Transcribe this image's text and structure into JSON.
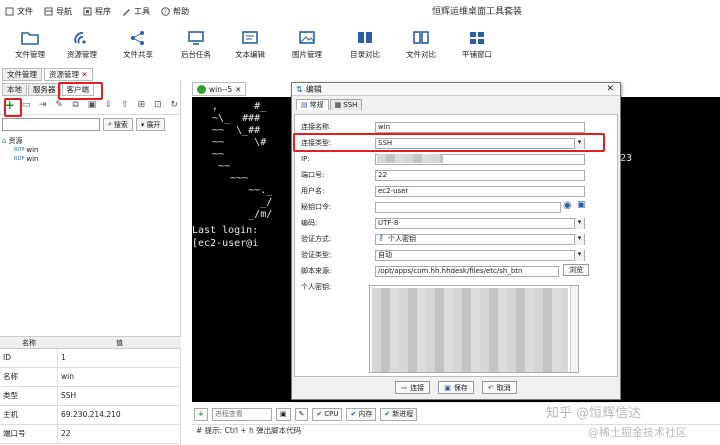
{
  "app": {
    "title": "恒辉运维桌面工具套装"
  },
  "menu": [
    {
      "label": "文件",
      "icon": "file-icon"
    },
    {
      "label": "导航",
      "icon": "navigation-icon"
    },
    {
      "label": "程序",
      "icon": "program-icon"
    },
    {
      "label": "工具",
      "icon": "tools-icon"
    },
    {
      "label": "帮助",
      "icon": "help-icon"
    }
  ],
  "toolbar": [
    {
      "label": "文件管理",
      "icon": "folder-icon"
    },
    {
      "label": "资源管理",
      "icon": "resource-icon"
    },
    {
      "label": "文件共享",
      "icon": "share-icon"
    },
    {
      "label": "后台任务",
      "icon": "monitor-icon"
    },
    {
      "label": "文本编辑",
      "icon": "text-edit-icon"
    },
    {
      "label": "图片管理",
      "icon": "image-icon"
    },
    {
      "label": "目录对比",
      "icon": "dir-compare-icon"
    },
    {
      "label": "文件对比",
      "icon": "file-compare-icon"
    },
    {
      "label": "平铺窗口",
      "icon": "tile-window-icon"
    }
  ],
  "top_tabs": [
    "文件管理",
    "资源管理"
  ],
  "sub_tabs": [
    "本地",
    "服务器",
    "客户端"
  ],
  "search": {
    "button": "搜索",
    "expand": "展开"
  },
  "tree": {
    "root": "资源",
    "children": [
      "win",
      "win"
    ]
  },
  "props": {
    "headers": [
      "名称",
      "值"
    ],
    "rows": [
      [
        "ID",
        "1"
      ],
      [
        "名称",
        "win"
      ],
      [
        "类型",
        "SSH"
      ],
      [
        "主机",
        "69.230.214.210"
      ],
      [
        "端口号",
        "22"
      ]
    ]
  },
  "terminal": {
    "tab_label": "win--5",
    "right_fragment": "23",
    "lines": [
      "  ,      #_",
      "  ~\\_  ###",
      "  ~~  \\_##",
      "  ~~     \\#",
      "  ~~",
      "   ~~",
      "     ~~~",
      "        ~~._",
      "          _/",
      "        _/m/",
      "Last login:",
      "[ec2-user@i"
    ]
  },
  "bottom": {
    "process_placeholder": "进程查看",
    "cpu": "CPU",
    "memory": "内存",
    "new_process": "新进程",
    "hint": "# 提示: Ctrl + h 弹出脚本代码"
  },
  "dialog": {
    "title": "编辑",
    "tabs": [
      "常规",
      "SSH"
    ],
    "fields": {
      "conn_name": {
        "label": "连接名称:",
        "value": "win"
      },
      "conn_type": {
        "label": "连接类型:",
        "value": "SSH"
      },
      "ip": {
        "label": "IP:",
        "value": ""
      },
      "port": {
        "label": "端口号:",
        "value": "22"
      },
      "username": {
        "label": "用户名:",
        "value": "ec2-user"
      },
      "password": {
        "label": "秘钥口令:",
        "value": ""
      },
      "encoding": {
        "label": "编码:",
        "value": "UTF-8"
      },
      "auth_method": {
        "label": "验证方式:",
        "value": "个人密钥"
      },
      "auth_type": {
        "label": "验证类型:",
        "value": "自动"
      },
      "script_source": {
        "label": "脚本来源:",
        "value": "/opt/apps/com.hh.hhdesk/files/etc/sh_btn",
        "browse": "浏览"
      },
      "private_key": {
        "label": "个人密钥:"
      }
    },
    "buttons": {
      "connect": "连接",
      "save": "保存",
      "cancel": "取消"
    }
  },
  "watermark": {
    "line1": "知乎 @恒辉信达",
    "line2": "@稀土掘金技术社区"
  },
  "colors": {
    "highlight_red": "#e02020",
    "terminal_bg": "#000000",
    "status_green": "#2aa52a",
    "accent_blue": "#2a5fa8"
  }
}
